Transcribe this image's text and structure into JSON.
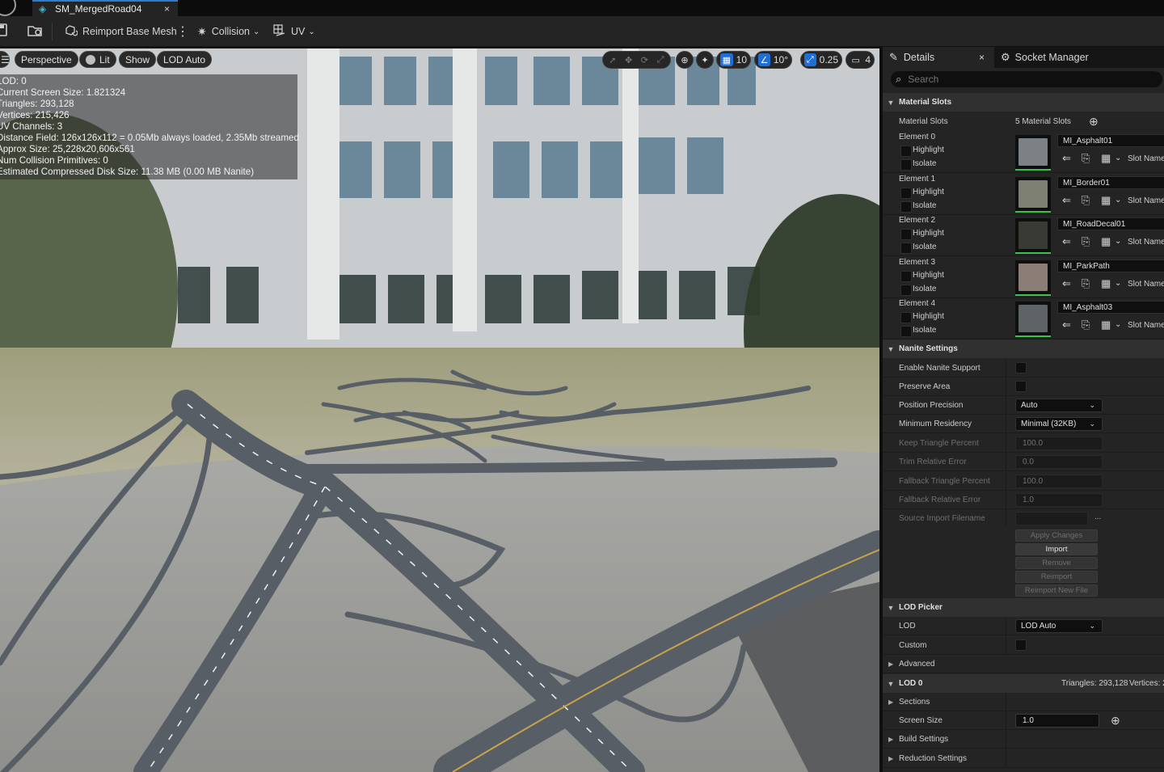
{
  "window": {
    "tab_title": "SM_MergedRoad04",
    "close_glyph": "×"
  },
  "toolbar": {
    "save_icon": "save-icon",
    "browse_icon": "browse-icon",
    "reimport_label": "Reimport Base Mesh",
    "more_glyph": "⋮",
    "collision_label": "Collision",
    "uv_label": "UV"
  },
  "viewport": {
    "menu_glyph": "☰",
    "perspective_label": "Perspective",
    "lit_label": "Lit",
    "show_label": "Show",
    "lod_label": "LOD Auto",
    "grid_snap_value": "10",
    "rotation_snap_value": "10°",
    "scale_snap_value": "0.25",
    "camera_speed_value": "4",
    "stats": [
      "LOD:  0",
      "Current Screen Size:  1.821324",
      "Triangles:  293,128",
      "Vertices:  215,426",
      "UV Channels:  3",
      "Distance Field:  126x126x112 = 0.05Mb always loaded, 2.35Mb streamed",
      "Approx Size: 25,228x20,606x561",
      "Num Collision Primitives:  0",
      "Estimated Compressed Disk Size: 11.38 MB (0.00 MB Nanite)"
    ]
  },
  "panel": {
    "details_tab": "Details",
    "details_close": "×",
    "socket_tab": "Socket Manager",
    "search_placeholder": "Search",
    "material_slots": {
      "header": "Material Slots",
      "label": "Material Slots",
      "count_text": "5 Material Slots",
      "highlight_label": "Highlight",
      "isolate_label": "Isolate",
      "slot_name_label": "Slot Name",
      "elements": [
        {
          "name": "Element 0",
          "material": "MI_Asphalt01",
          "swatch": "#7b8185"
        },
        {
          "name": "Element 1",
          "material": "MI_Border01",
          "swatch": "#7c7f72"
        },
        {
          "name": "Element 2",
          "material": "MI_RoadDecal01",
          "swatch": "#3a3a34"
        },
        {
          "name": "Element 3",
          "material": "MI_ParkPath",
          "swatch": "#8a7e76"
        },
        {
          "name": "Element 4",
          "material": "MI_Asphalt03",
          "swatch": "#5e6366"
        }
      ]
    },
    "nanite": {
      "header": "Nanite Settings",
      "enable_label": "Enable Nanite Support",
      "preserve_label": "Preserve Area",
      "position_precision_label": "Position Precision",
      "position_precision_value": "Auto",
      "min_residency_label": "Minimum Residency",
      "min_residency_value": "Minimal (32KB)",
      "keep_tri_label": "Keep Triangle Percent",
      "keep_tri_value": "100.0",
      "trim_err_label": "Trim Relative Error",
      "trim_err_value": "0.0",
      "fallback_tri_label": "Fallback Triangle Percent",
      "fallback_tri_value": "100.0",
      "fallback_err_label": "Fallback Relative Error",
      "fallback_err_value": "1.0",
      "source_import_label": "Source Import Filename",
      "source_import_ellipsis": "...",
      "apply_changes_label": "Apply Changes",
      "import_label": "Import",
      "remove_label": "Remove",
      "reimport_label": "Reimport",
      "reimport_new_label": "Reimport New File"
    },
    "lod_picker": {
      "header": "LOD Picker",
      "lod_label": "LOD",
      "lod_value": "LOD Auto",
      "custom_label": "Custom",
      "advanced_label": "Advanced"
    },
    "lod0": {
      "header": "LOD 0",
      "triangles_text": "Triangles: 293,128",
      "vertices_text": "Vertices: 2",
      "sections_label": "Sections",
      "screen_size_label": "Screen Size",
      "screen_size_value": "1.0",
      "build_settings_label": "Build Settings",
      "reduction_settings_label": "Reduction Settings"
    }
  },
  "colors": {
    "accent_blue": "#1f6fd6",
    "status_green": "#3fbf4c",
    "panel_bg": "#242424",
    "tab_accent": "#2d7ecf"
  }
}
